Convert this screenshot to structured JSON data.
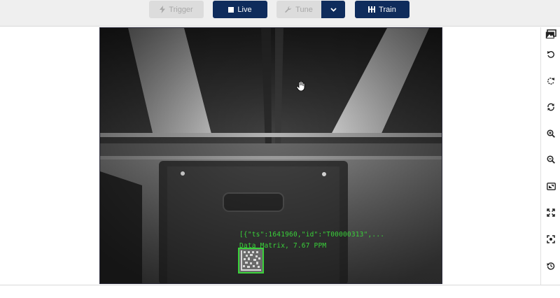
{
  "toolbar": {
    "trigger_label": "Trigger",
    "live_label": "Live",
    "tune_label": "Tune",
    "train_label": "Train"
  },
  "icons": {
    "trigger": "lightning-icon",
    "live": "stop-square-icon",
    "tune": "wrench-icon",
    "dropdown": "chevron-down-icon",
    "train": "train-bars-icon",
    "sidebar": [
      "image-stack-icon",
      "rotate-left-icon",
      "rotate-right-icon",
      "refresh-icon",
      "zoom-in-icon",
      "zoom-out-icon",
      "fit-to-window-icon",
      "fullscreen-icon",
      "focus-icon",
      "history-icon"
    ]
  },
  "overlay": {
    "result_string": "[{\"ts\":1641960,\"id\":\"T00000313\",...",
    "symbology": "Data Matrix, 7.67 PPM"
  },
  "colors": {
    "primary": "#0f2c5c",
    "disabled": "#dcdcdc",
    "overlay_green": "#3ad13a"
  }
}
